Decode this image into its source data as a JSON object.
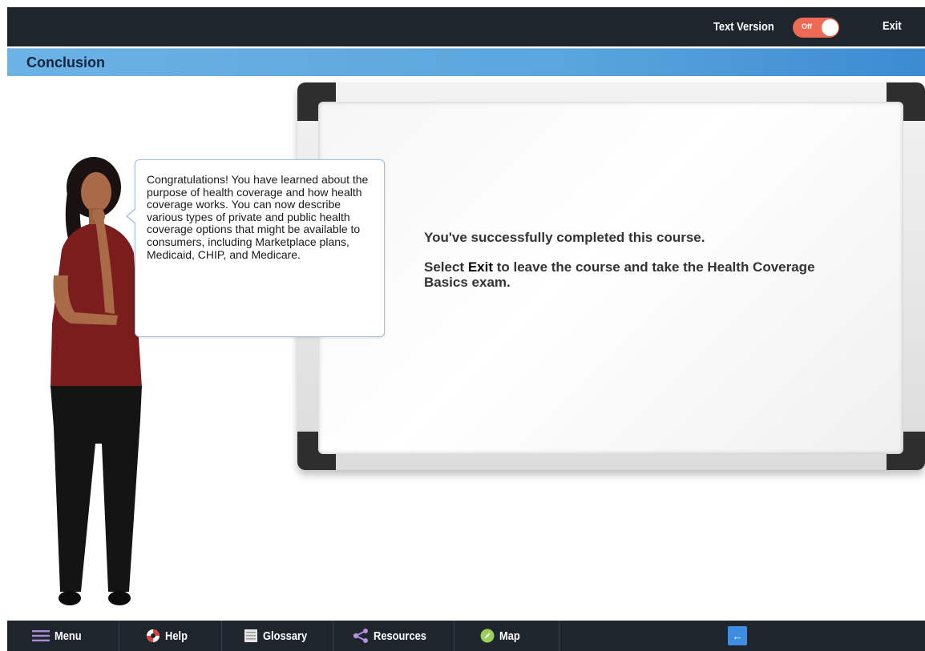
{
  "topbar": {
    "text_version_label": "Text Version",
    "toggle_state": "Off",
    "exit_label": "Exit"
  },
  "page": {
    "title": "Conclusion"
  },
  "bubble": {
    "text": "Congratulations! You have learned about the purpose of health coverage and how health coverage works.  You can now describe various types of private and public health coverage options that might be available to consumers, including Marketplace plans, Medicaid, CHIP, and Medicare."
  },
  "board": {
    "line1": "You've successfully completed this course.",
    "line2_prefix": "Select ",
    "line2_strong": "Exit",
    "line2_suffix": " to leave the course and take the Health Coverage Basics exam."
  },
  "nav": {
    "menu": "Menu",
    "help": "Help",
    "glossary": "Glossary",
    "resources": "Resources",
    "map": "Map",
    "back_icon": "arrow-left-icon"
  },
  "colors": {
    "bar_dark": "#1e252d",
    "title_blue": "#5aa6dd",
    "toggle_off": "#ef6a55",
    "back_button": "#3d8ee0"
  }
}
